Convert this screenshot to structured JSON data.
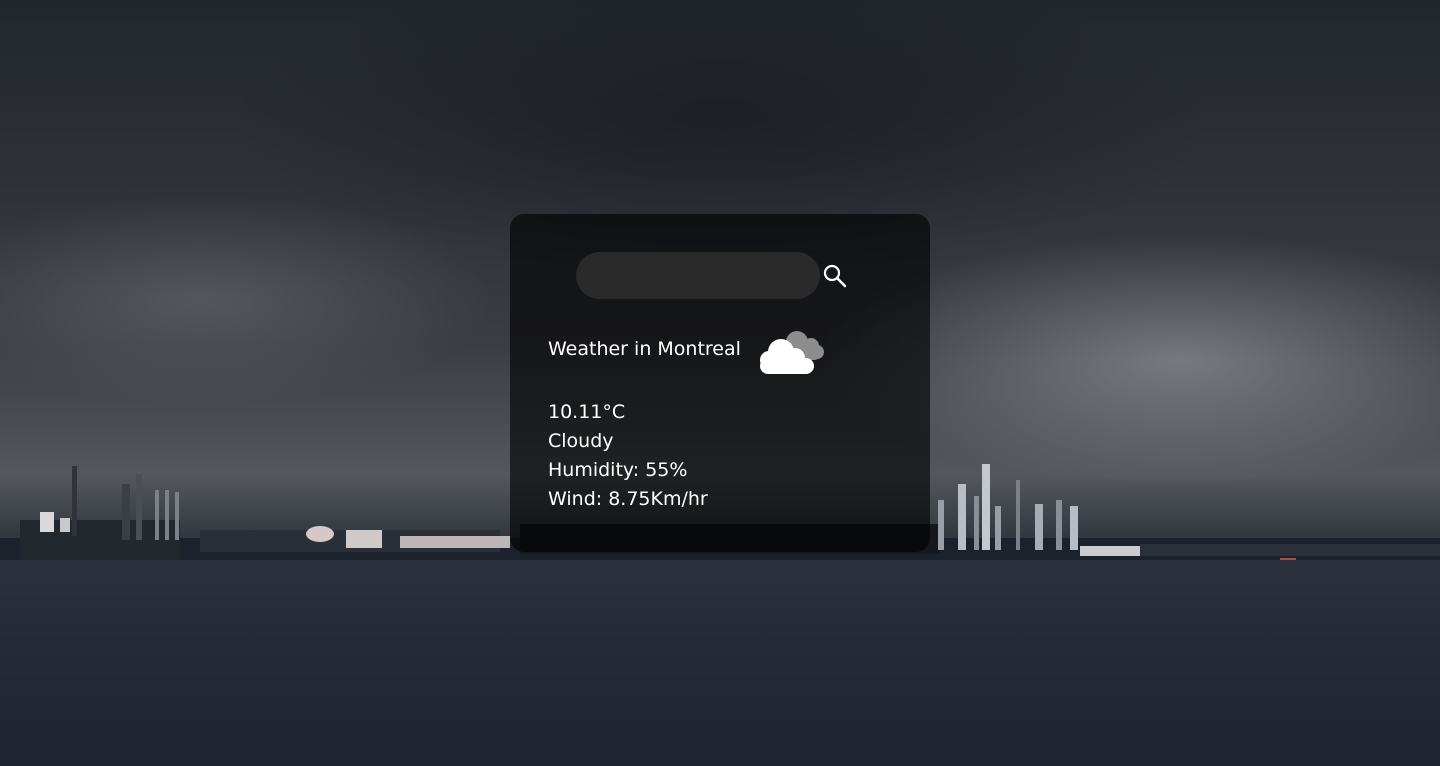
{
  "search": {
    "value": "",
    "placeholder": ""
  },
  "weather": {
    "title": "Weather in Montreal",
    "temperature": "10.11°C",
    "description": "Cloudy",
    "humidity": "Humidity: 55%",
    "wind": "Wind: 8.75Km/hr",
    "icon": "cloud-icon"
  },
  "colors": {
    "card_background": "#000000",
    "text": "#ffffff",
    "search_background": "#2a2a2a"
  }
}
